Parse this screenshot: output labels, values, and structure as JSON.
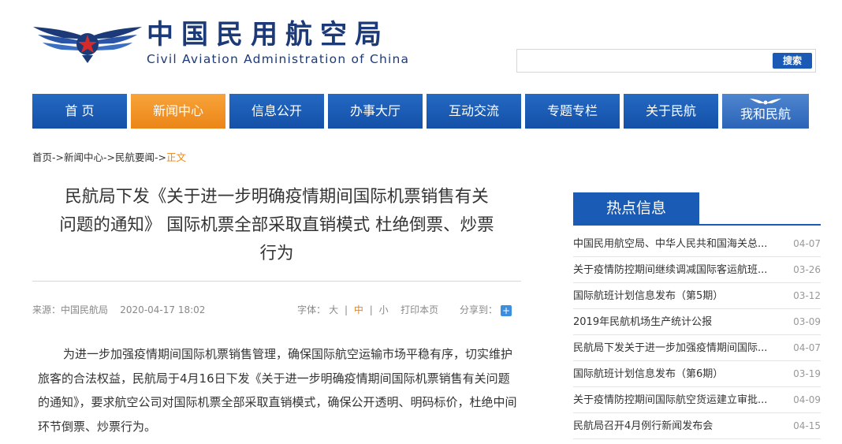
{
  "header": {
    "title_cn": "中国民用航空局",
    "title_en": "Civil Aviation Administration of China",
    "search": {
      "placeholder": "",
      "button_label": "搜索"
    }
  },
  "nav": {
    "items": [
      "首 页",
      "新闻中心",
      "信息公开",
      "办事大厅",
      "互动交流",
      "专题专栏",
      "关于民航",
      "我和民航"
    ],
    "active_index": 1
  },
  "breadcrumb": {
    "items": [
      "首页",
      "新闻中心",
      "民航要闻"
    ],
    "separator": "->",
    "current": "正文"
  },
  "article": {
    "title_lines": [
      "民航局下发《关于进一步明确疫情期间国际机票销售有关",
      "问题的通知》 国际机票全部采取直销模式 杜绝倒票、炒票",
      "行为"
    ],
    "source": "来源：中国民航局",
    "date": "2020-04-17 18:02",
    "font_label": "字体：",
    "font_large": "大",
    "font_medium": "中",
    "font_small": "小",
    "print_label": "打印本页",
    "share_label": "分享到：",
    "share_symbol": "+",
    "body": "为进一步加强疫情期间国际机票销售管理，确保国际航空运输市场平稳有序，切实维护旅客的合法权益，民航局于4月16日下发《关于进一步明确疫情期间国际机票销售有关问题的通知》，要求航空公司对国际机票全部采取直销模式，确保公开透明、明码标价，杜绝中间环节倒票、炒票行为。"
  },
  "hot": {
    "title": "热点信息",
    "items": [
      {
        "title": "中国民用航空局、中华人民共和国海关总...",
        "date": "04-07"
      },
      {
        "title": "关于疫情防控期间继续调减国际客运航班...",
        "date": "03-26"
      },
      {
        "title": "国际航班计划信息发布（第5期）",
        "date": "03-12"
      },
      {
        "title": "2019年民航机场生产统计公报",
        "date": "03-09"
      },
      {
        "title": "民航局下发关于进一步加强疫情期间国际...",
        "date": "04-07"
      },
      {
        "title": "国际航班计划信息发布（第6期）",
        "date": "03-19"
      },
      {
        "title": "关于疫情防控期间国际航空货运建立审批...",
        "date": "04-09"
      },
      {
        "title": "民航局召开4月例行新闻发布会",
        "date": "04-15"
      }
    ]
  },
  "colors": {
    "nav_blue": "#1a5cb5",
    "nav_active": "#ec8517",
    "brand_navy": "#1d3a78",
    "emblem_red": "#d42a2a"
  }
}
